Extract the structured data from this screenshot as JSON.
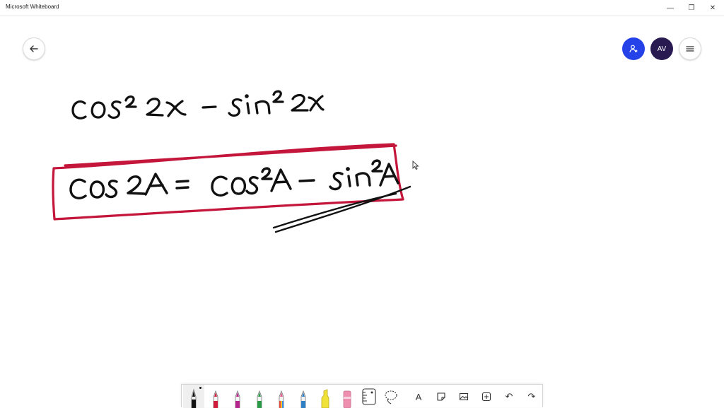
{
  "window": {
    "title": "Microsoft Whiteboard",
    "controls": {
      "minimize": "—",
      "maximize": "❐",
      "close": "✕"
    }
  },
  "header": {
    "avatar_initials": "AV",
    "accent_color": "#2541e8",
    "avatar_color": "#2a1a52"
  },
  "ink": {
    "colors": {
      "black": "#111111",
      "box": "#c4153a"
    }
  },
  "toolbar": {
    "tools": [
      {
        "id": "pen-black",
        "icon": "pen-icon",
        "color": "#111111",
        "active": true
      },
      {
        "id": "pen-red",
        "icon": "pen-icon",
        "color": "#d01c3b"
      },
      {
        "id": "pen-magenta",
        "icon": "pen-icon",
        "color": "#b4268a"
      },
      {
        "id": "pen-green",
        "icon": "pen-icon",
        "color": "#2a9a48"
      },
      {
        "id": "pen-rainbow",
        "icon": "pen-icon",
        "color": "#e05c8c"
      },
      {
        "id": "pen-blue",
        "icon": "pen-icon",
        "color": "#2f7fc4"
      },
      {
        "id": "highlighter",
        "icon": "highlighter-icon",
        "color": "#f1e23a"
      },
      {
        "id": "eraser",
        "icon": "eraser-icon",
        "color": "#ef8fb0"
      },
      {
        "id": "ruler",
        "icon": "ruler-icon"
      },
      {
        "id": "lasso",
        "icon": "lasso-icon"
      },
      {
        "id": "text",
        "icon": "text-icon",
        "glyph": "A"
      },
      {
        "id": "sticky-note",
        "icon": "note-icon"
      },
      {
        "id": "image",
        "icon": "image-icon"
      },
      {
        "id": "insert",
        "icon": "add-icon"
      },
      {
        "id": "undo",
        "icon": "undo-icon",
        "glyph": "↶"
      },
      {
        "id": "redo",
        "icon": "redo-icon",
        "glyph": "↷"
      }
    ]
  }
}
